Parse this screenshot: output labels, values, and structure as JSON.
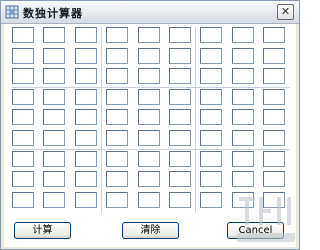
{
  "window": {
    "title": "数独计算器",
    "close_label": "✕"
  },
  "grid": {
    "rows": 9,
    "cols": 9,
    "values": [
      [
        "",
        "",
        "",
        "",
        "",
        "",
        "",
        "",
        ""
      ],
      [
        "",
        "",
        "",
        "",
        "",
        "",
        "",
        "",
        ""
      ],
      [
        "",
        "",
        "",
        "",
        "",
        "",
        "",
        "",
        ""
      ],
      [
        "",
        "",
        "",
        "",
        "",
        "",
        "",
        "",
        ""
      ],
      [
        "",
        "",
        "",
        "",
        "",
        "",
        "",
        "",
        ""
      ],
      [
        "",
        "",
        "",
        "",
        "",
        "",
        "",
        "",
        ""
      ],
      [
        "",
        "",
        "",
        "",
        "",
        "",
        "",
        "",
        ""
      ],
      [
        "",
        "",
        "",
        "",
        "",
        "",
        "",
        "",
        ""
      ],
      [
        "",
        "",
        "",
        "",
        "",
        "",
        "",
        "",
        ""
      ]
    ]
  },
  "buttons": {
    "calculate_label": "计算",
    "clear_label": "清除",
    "cancel_label": "Cancel"
  },
  "icons": {
    "app": "sudoku-app-icon",
    "close": "close-icon"
  },
  "colors": {
    "cell_border": "#7f9db9",
    "button_border": "#003c74",
    "dialog_background": "#ece9d8"
  }
}
